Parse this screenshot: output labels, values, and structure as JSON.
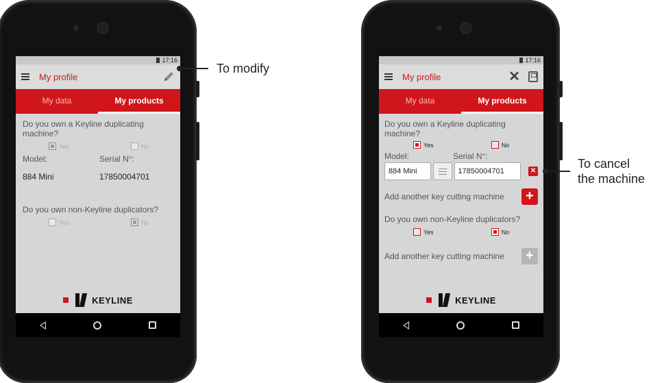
{
  "left_screen": {
    "status_time": "17:16",
    "title": "My profile",
    "tabs": [
      "My data",
      "My products"
    ],
    "q1": "Do you own a Keyline duplicating machine?",
    "yes": "Yes",
    "no": "No",
    "model_label": "Model:",
    "serial_label": "Serial N°:",
    "model_value": "884 Mini",
    "serial_value": "17850004701",
    "q2": "Do you own non-Keyline duplicators?",
    "logo": "KEYLINE"
  },
  "right_screen": {
    "status_time": "17:16",
    "title": "My profile",
    "tabs": [
      "My data",
      "My products"
    ],
    "q1": "Do you own a Keyline duplicating machine?",
    "yes": "Yes",
    "no": "No",
    "model_label": "Model:",
    "serial_label": "Serial N°:",
    "model_value": "884 Mini",
    "serial_value": "17850004701",
    "add_machine": "Add another key cutting machine",
    "q2": "Do you own non-Keyline duplicators?",
    "add_machine_2": "Add another key cutting machine",
    "logo": "KEYLINE"
  },
  "annotations": {
    "modify": "To modify",
    "cancel_line1": "To cancel",
    "cancel_line2": "the machine"
  },
  "colors": {
    "brand_red": "#d0161b"
  }
}
